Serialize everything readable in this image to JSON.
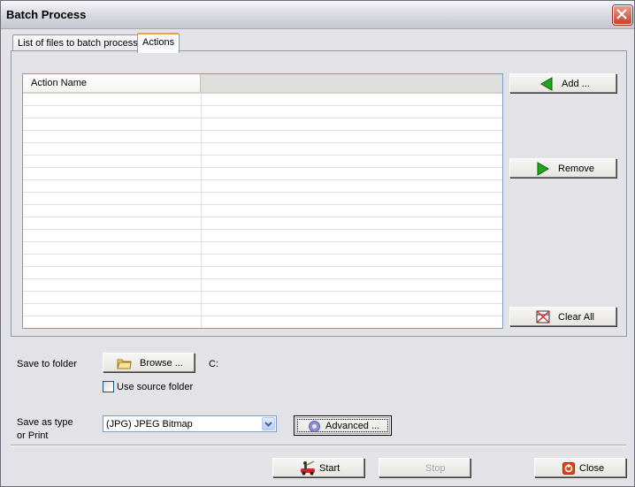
{
  "window": {
    "title": "Batch Process",
    "close_icon": "close-x-icon"
  },
  "tabs": [
    {
      "label": "List of files to batch process",
      "active": false
    },
    {
      "label": "Actions",
      "active": true
    }
  ],
  "actions_list": {
    "columns": [
      "Action Name",
      ""
    ],
    "rows": []
  },
  "side_buttons": {
    "add": {
      "label": "Add ...",
      "icon": "green-left-arrow-icon"
    },
    "remove": {
      "label": "Remove",
      "icon": "green-right-arrow-icon"
    },
    "clear_all": {
      "label": "Clear All",
      "icon": "clear-table-icon"
    }
  },
  "save_folder": {
    "label": "Save to folder",
    "browse_label": "Browse ...",
    "browse_icon": "folder-icon",
    "path": "C:",
    "use_source_label": "Use source folder",
    "use_source_checked": false
  },
  "save_type": {
    "label_line1": "Save as type",
    "label_line2": "or Print",
    "selected": "(JPG) JPEG Bitmap",
    "advanced_label": "Advanced ...",
    "advanced_icon": "gear-icon"
  },
  "footer": {
    "start_label": "Start",
    "stop_label": "Stop",
    "stop_enabled": false,
    "close_label": "Close"
  }
}
